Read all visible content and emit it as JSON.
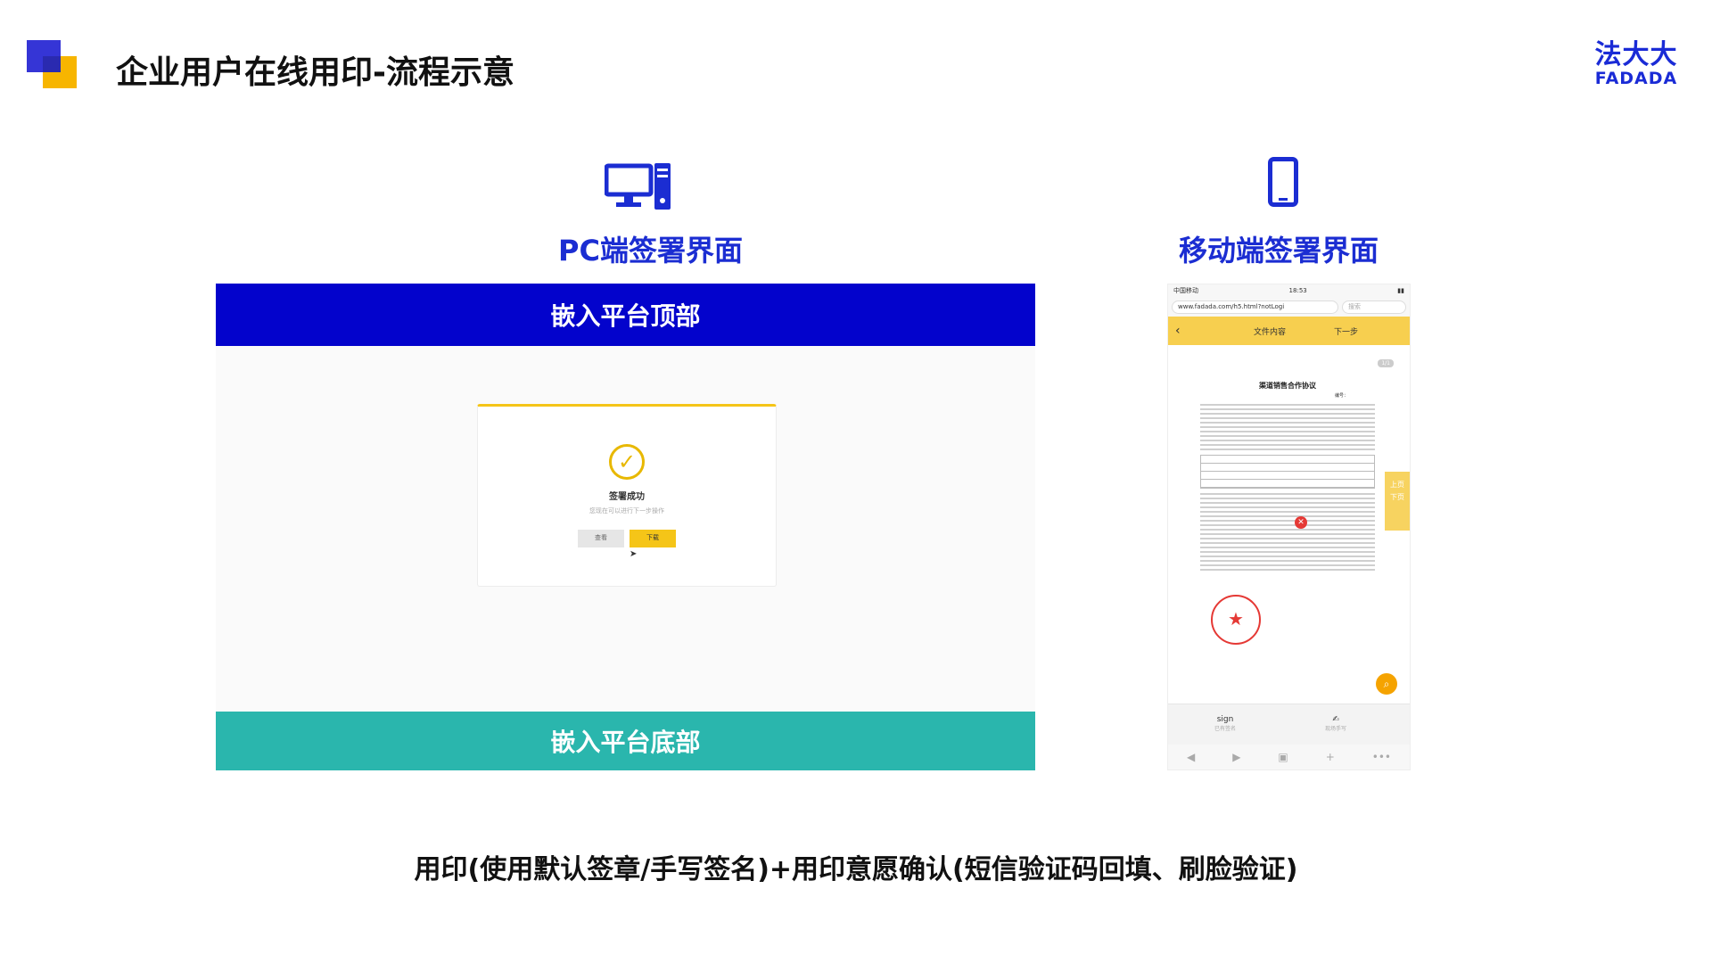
{
  "header": {
    "title": "企业用户在线用印-流程示意",
    "brand_cn": "法大大",
    "brand_en": "FADADA"
  },
  "pc": {
    "heading": "PC端签署界面",
    "icon": "desktop-computer-icon",
    "top_bar": "嵌入平台顶部",
    "bottom_bar": "嵌入平台底部",
    "dialog": {
      "title": "签署成功",
      "subtitle": "您现在可以进行下一步操作",
      "view_button": "查看",
      "download_button": "下载"
    }
  },
  "mobile": {
    "heading": "移动端签署界面",
    "icon": "mobile-phone-icon",
    "status": {
      "carrier": "中国移动",
      "time": "18:53"
    },
    "url": "www.fadada.com/h5.html?notLogi",
    "search_placeholder": "搜索",
    "nav": {
      "title": "文件内容",
      "next": "下一步"
    },
    "page_indicator": "1/1",
    "document": {
      "title": "渠道销售合作协议",
      "number_label": "编号："
    },
    "side_tab": {
      "up": "上页",
      "down": "下页"
    },
    "sign_bar": {
      "left_label": "sign",
      "left_sub": "已有签名",
      "right_sub": "现场手写"
    }
  },
  "caption": "用印(使用默认签章/手写签名)+用印意愿确认(短信验证码回填、刷脸验证)",
  "colors": {
    "accent_blue": "#1b2dd2",
    "top_bar": "#0303cc",
    "bottom_bar": "#2ab6ad",
    "yellow": "#f7cf4f"
  }
}
